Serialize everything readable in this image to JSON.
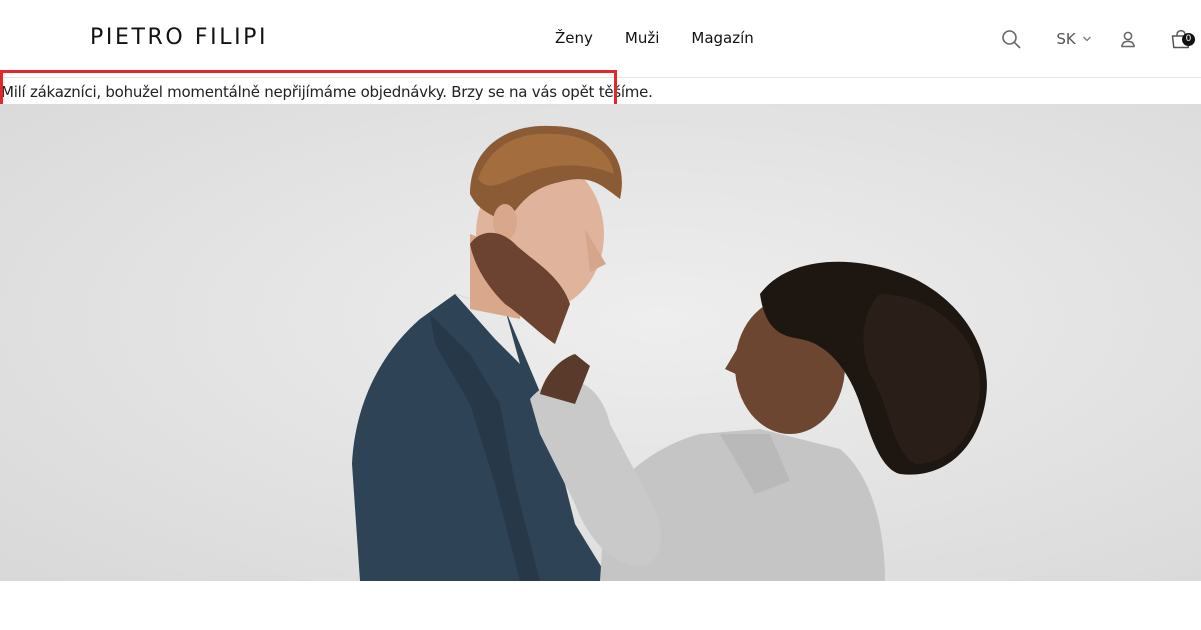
{
  "brand": {
    "logo_text": "PIETRO FILIPI"
  },
  "nav": {
    "items": [
      {
        "label": "Ženy"
      },
      {
        "label": "Muži"
      },
      {
        "label": "Magazín"
      }
    ]
  },
  "header_actions": {
    "search_icon": "search-icon",
    "language": "SK",
    "language_icon": "chevron-down-icon",
    "account_icon": "user-icon",
    "cart_icon": "shopping-bag-icon",
    "cart_count": "0"
  },
  "notice": {
    "text": "Milí zákazníci, bohužel momentálně nepřijímáme objednávky. Brzy se na vás opět těšíme.",
    "highlight_color": "#e4262a"
  },
  "hero": {
    "background_color": "#e3e3e3"
  }
}
